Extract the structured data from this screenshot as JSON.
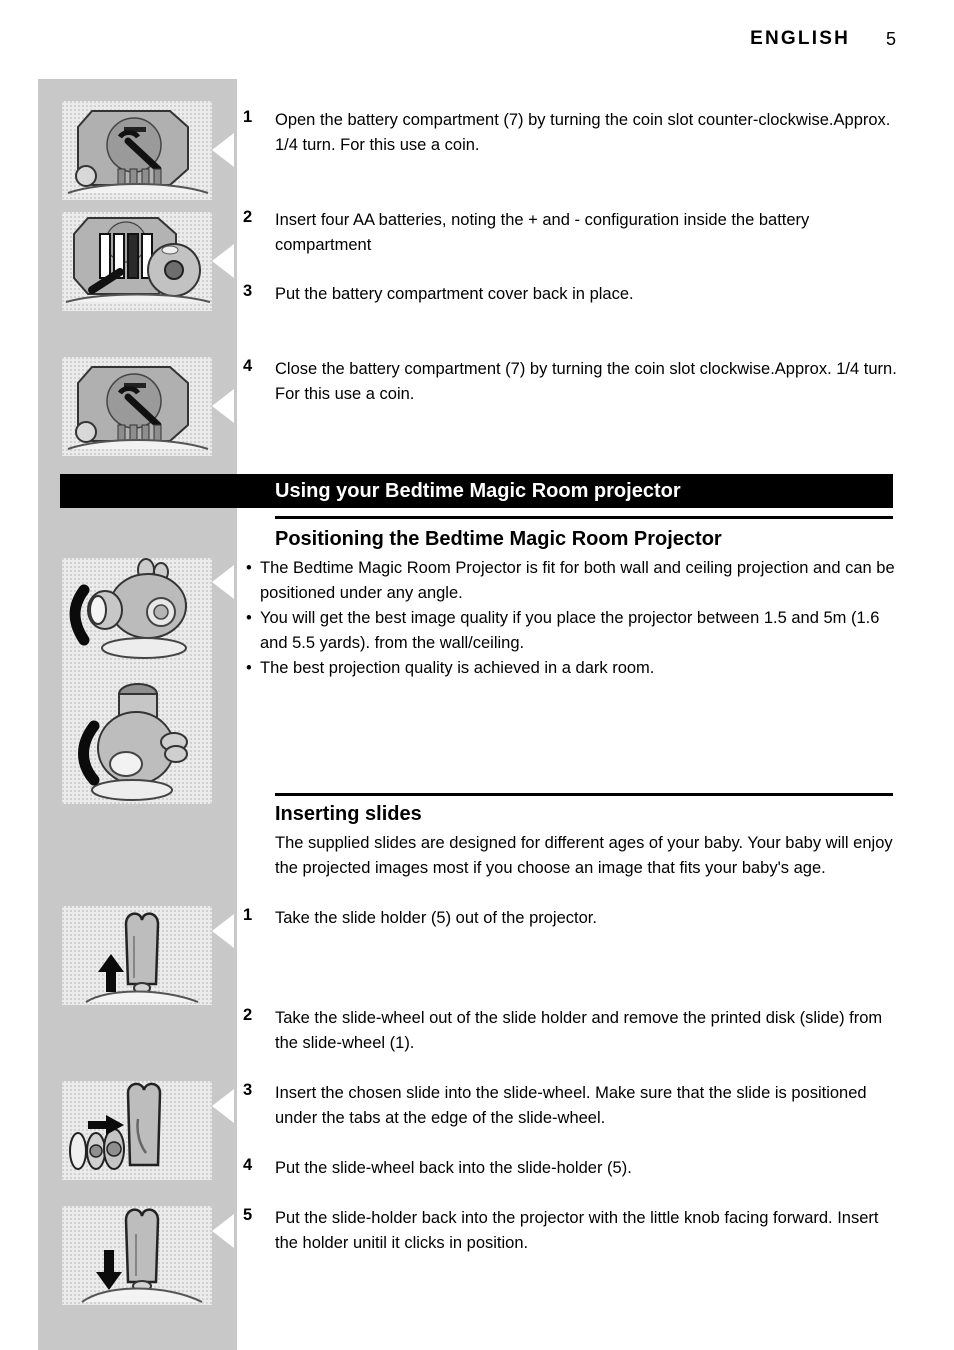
{
  "header": {
    "language": "ENGLISH",
    "page_number": "5"
  },
  "battery_steps": [
    {
      "number": "1",
      "text": "Open the battery compartment (7) by turning the coin slot counter-clockwise.Approx. 1/4 turn. For this use a coin."
    },
    {
      "number": "2",
      "text": "Insert four AA batteries, noting the + and - configuration inside the battery compartment"
    },
    {
      "number": "3",
      "text": "Put the battery compartment cover back in place."
    },
    {
      "number": "4",
      "text": "Close the battery compartment (7) by turning the coin slot clockwise.Approx. 1/4 turn. For this use a coin."
    }
  ],
  "banner": {
    "title": "Using your Bedtime Magic Room projector"
  },
  "positioning": {
    "heading": "Positioning the Bedtime Magic Room Projector",
    "bullets": [
      "The Bedtime Magic Room Projector is fit for both wall and ceiling projection and can be positioned under any angle.",
      "You will get the best image quality if you place the projector between 1.5 and 5m (1.6 and 5.5 yards). from the wall/ceiling.",
      "The best projection quality is achieved in a dark room."
    ],
    "bullet_marker": "•"
  },
  "inserting_slides": {
    "heading": "Inserting slides",
    "intro": "The supplied slides are designed for different ages of your baby. Your baby will enjoy the projected images most if you choose an image that fits your baby's age.",
    "steps": [
      {
        "number": "1",
        "text": "Take the slide holder (5) out of the projector."
      },
      {
        "number": "2",
        "text": "Take the slide-wheel out of the slide holder and remove the printed disk (slide) from the slide-wheel (1)."
      },
      {
        "number": "3",
        "text": "Insert the chosen slide into the slide-wheel. Make sure that the slide is positioned under the tabs at the edge of the slide-wheel."
      },
      {
        "number": "4",
        "text": "Put the slide-wheel back into the slide-holder (5)."
      },
      {
        "number": "5",
        "text": "Put the slide-holder back into the projector with the little knob facing forward. Insert the holder unitil it clicks in position."
      }
    ]
  },
  "figures": [
    {
      "name": "battery-compartment-open-illustration",
      "caption": ""
    },
    {
      "name": "battery-insert-illustration",
      "caption": ""
    },
    {
      "name": "battery-compartment-close-illustration",
      "caption": ""
    },
    {
      "name": "projector-positioning-illustration",
      "caption": ""
    },
    {
      "name": "slide-holder-remove-illustration",
      "caption": ""
    },
    {
      "name": "slide-wheel-illustration",
      "caption": ""
    },
    {
      "name": "slide-holder-insert-illustration",
      "caption": ""
    }
  ],
  "colors": {
    "sidebar_gray": "#c8c8c8",
    "figure_background": "#ebebeb",
    "banner_black": "#000000",
    "text_black": "#000000"
  }
}
